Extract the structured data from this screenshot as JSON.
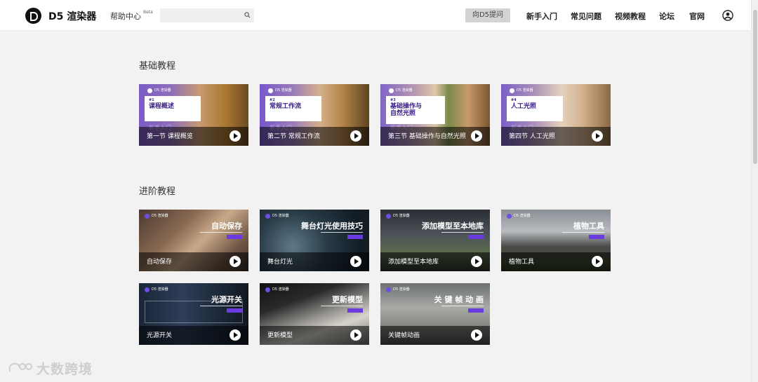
{
  "header": {
    "brand": "D5 渲染器",
    "help": "帮助中心",
    "beta": "Beta",
    "search_placeholder": "",
    "ask_button": "向D5提问",
    "nav": [
      "新手入门",
      "常见问题",
      "视频教程",
      "论坛",
      "官网"
    ]
  },
  "sections": {
    "basic_title": "基础教程",
    "advanced_title": "进阶教程"
  },
  "basic_cards": [
    {
      "num": "#1",
      "title": "课程概述",
      "tag": "新手入门",
      "label": "第一节 课程概览"
    },
    {
      "num": "#2",
      "title": "常规工作流",
      "tag": "新手入门",
      "label": "第二节 常规工作流"
    },
    {
      "num": "#3",
      "title": "基础操作与自然光照",
      "tag": "新手入门",
      "label": "第三节 基础操作与自然光照"
    },
    {
      "num": "#4",
      "title": "人工光照",
      "tag": "新手入门",
      "label": "第四节 人工光照"
    }
  ],
  "card_brand": "D5 渲染器",
  "advanced_cards": [
    {
      "title": "自动保存",
      "label": "自动保存"
    },
    {
      "title": "舞台灯光使用技巧",
      "label": "舞台灯光"
    },
    {
      "title": "添加模型至本地库",
      "label": "添加模型至本地库"
    },
    {
      "title": "植物工具",
      "label": "植物工具"
    },
    {
      "title": "光源开关",
      "label": "光源开关"
    },
    {
      "title": "更新模型",
      "label": "更新模型"
    },
    {
      "title": "关 键 帧 动 画",
      "label": "关键帧动画"
    }
  ],
  "watermark": "大数跨境",
  "icons": {
    "search": "search-icon",
    "user": "user-icon",
    "play": "play-icon",
    "logo": "d5-logo-icon"
  },
  "colors": {
    "accent_purple": "#6a3ce0",
    "title_purple": "#3b1e86"
  }
}
